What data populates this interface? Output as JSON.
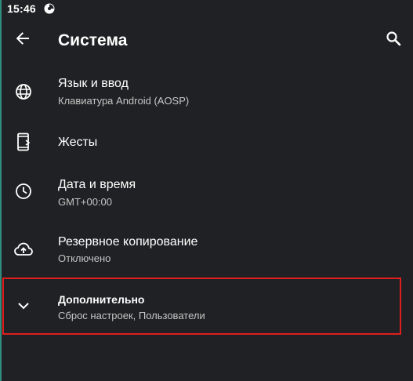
{
  "status_bar": {
    "time": "15:46"
  },
  "app_bar": {
    "title": "Система",
    "back_icon": "arrow-back-icon",
    "search_icon": "search-icon"
  },
  "items": [
    {
      "title": "Язык и ввод",
      "summary": "Клавиатура Android (AOSP)",
      "icon": "globe-icon"
    },
    {
      "title": "Жесты",
      "summary": "",
      "icon": "gestures-phone-icon"
    },
    {
      "title": "Дата и время",
      "summary": "GMT+00:00",
      "icon": "clock-icon"
    },
    {
      "title": "Резервное копирование",
      "summary": "Отключено",
      "icon": "cloud-upload-icon"
    },
    {
      "title": "Дополнительно",
      "summary": "Сброс настроек, Пользователи",
      "icon": "chevron-down-icon"
    }
  ],
  "colors": {
    "background": "#202124",
    "text_primary": "#ffffff",
    "text_secondary": "#c4c7c5",
    "highlight_border": "#e01e1e"
  }
}
